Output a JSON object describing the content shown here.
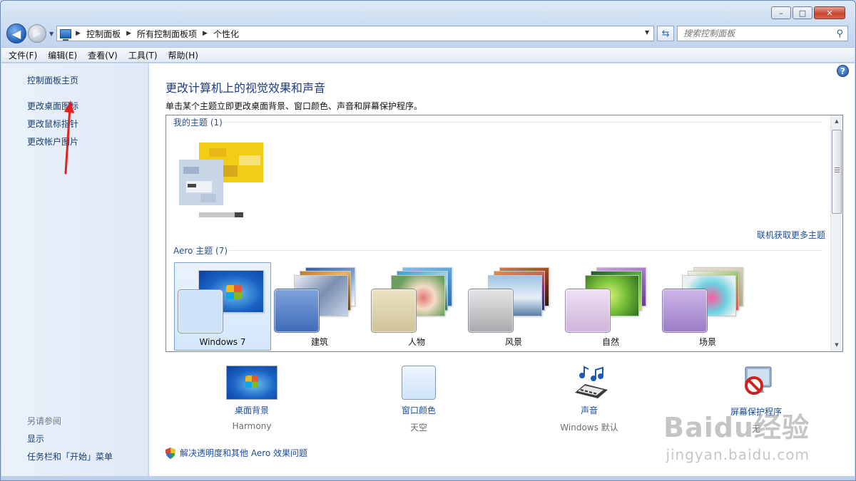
{
  "window": {
    "caption_minimize": "–",
    "caption_maximize": "□",
    "caption_close": "✕"
  },
  "address": {
    "crumbs": [
      "控制面板",
      "所有控制面板项",
      "个性化"
    ],
    "search_placeholder": "搜索控制面板"
  },
  "menu": [
    "文件(F)",
    "编辑(E)",
    "查看(V)",
    "工具(T)",
    "帮助(H)"
  ],
  "left_panel": {
    "home": "控制面板主页",
    "links": [
      "更改桌面图标",
      "更改鼠标指针",
      "更改帐户图片"
    ],
    "see_also_header": "另请参阅",
    "see_also": [
      "显示",
      "任务栏和「开始」菜单"
    ]
  },
  "main": {
    "title": "更改计算机上的视觉效果和声音",
    "description": "单击某个主题立即更改桌面背景、窗口颜色、声音和屏幕保护程序。",
    "my_themes_header": "我的主题 (1)",
    "online_link": "联机获取更多主题",
    "aero_header": "Aero 主题 (7)",
    "aero_themes": [
      {
        "name": "Windows 7",
        "selected": true,
        "swatch_color": "#cfe3f8"
      },
      {
        "name": "建筑",
        "selected": false,
        "swatch_color": "#5d86c9"
      },
      {
        "name": "人物",
        "selected": false,
        "swatch_color": "#d9cfa8"
      },
      {
        "name": "风景",
        "selected": false,
        "swatch_color": "#c0c0c2"
      },
      {
        "name": "自然",
        "selected": false,
        "swatch_color": "#dfc9e6"
      },
      {
        "name": "场景",
        "selected": false,
        "swatch_color": "#b69bd2"
      }
    ],
    "bottom_items": [
      {
        "label": "桌面背景",
        "value": "Harmony"
      },
      {
        "label": "窗口颜色",
        "value": "天空"
      },
      {
        "label": "声音",
        "value": "Windows 默认"
      },
      {
        "label": "屏幕保护程序",
        "value": "无"
      }
    ],
    "fix_link": "解决透明度和其他 Aero 效果问题"
  },
  "watermark": {
    "main": "Baidu经验",
    "sub": "jingyan.baidu.com"
  },
  "colors": {
    "link": "#1a4c9c",
    "title": "#1e3a8a",
    "selection": "#d4e7fb",
    "annotation_arrow": "#e0231c"
  }
}
